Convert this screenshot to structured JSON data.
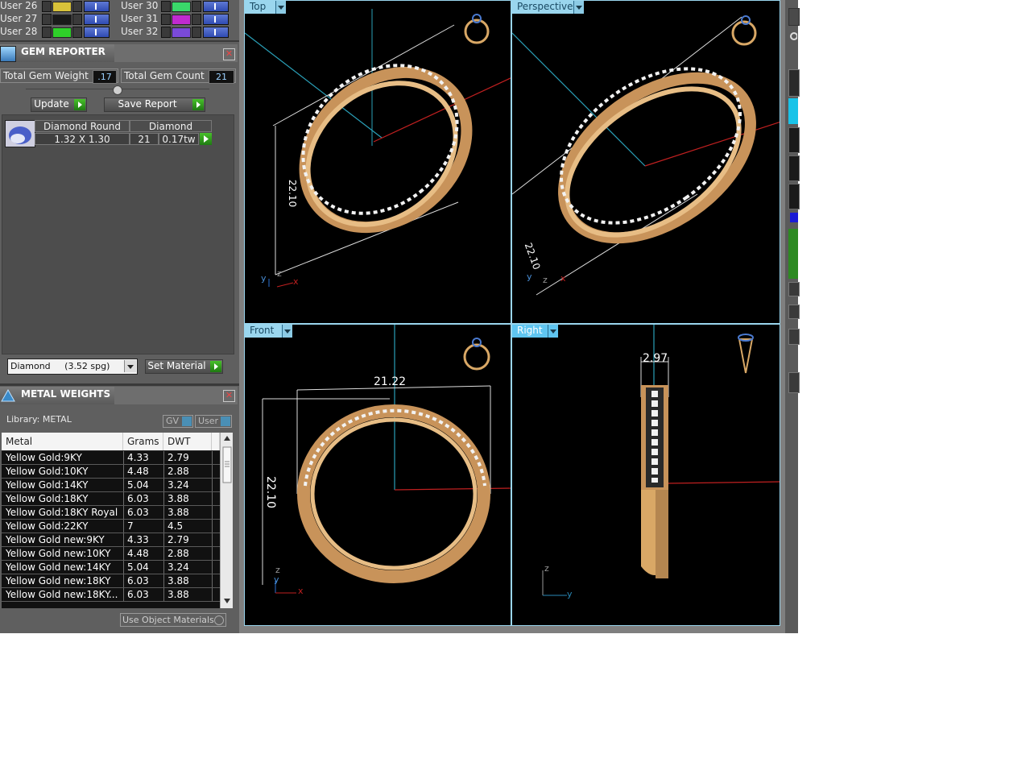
{
  "layers": [
    {
      "name": "User 26",
      "color": "#d8c23a"
    },
    {
      "name": "User 27",
      "color": "#1a1a1a"
    },
    {
      "name": "User 28",
      "color": "#2fd12a"
    },
    {
      "name": "User 30",
      "color": "#3ad86a"
    },
    {
      "name": "User 31",
      "color": "#c02ad0"
    },
    {
      "name": "User 32",
      "color": "#7a4ad8"
    }
  ],
  "gem_reporter": {
    "title": "GEM REPORTER",
    "total_weight_label": "Total Gem Weight",
    "total_weight_value": ".17",
    "total_count_label": "Total Gem Count",
    "total_count_value": "21",
    "update_label": "Update",
    "save_label": "Save Report",
    "gem": {
      "shape": "Diamond Round",
      "type": "Diamond",
      "size": "1.32 X 1.30",
      "count": "21",
      "weight": "0.17tw"
    },
    "material_select": "Diamond     (3.52 spg)",
    "set_material_label": "Set Material"
  },
  "metal_weights": {
    "title": "METAL WEIGHTS",
    "library_label": "Library: METAL",
    "gv_label": "GV",
    "user_label": "User",
    "columns": [
      "Metal",
      "Grams",
      "DWT"
    ],
    "rows": [
      [
        "Yellow Gold:9KY",
        "4.33",
        "2.79"
      ],
      [
        "Yellow Gold:10KY",
        "4.48",
        "2.88"
      ],
      [
        "Yellow Gold:14KY",
        "5.04",
        "3.24"
      ],
      [
        "Yellow Gold:18KY",
        "6.03",
        "3.88"
      ],
      [
        "Yellow Gold:18KY Royal",
        "6.03",
        "3.88"
      ],
      [
        "Yellow Gold:22KY",
        "7",
        "4.5"
      ],
      [
        "Yellow Gold new:9KY",
        "4.33",
        "2.79"
      ],
      [
        "Yellow Gold new:10KY",
        "4.48",
        "2.88"
      ],
      [
        "Yellow Gold new:14KY",
        "5.04",
        "3.24"
      ],
      [
        "Yellow Gold new:18KY",
        "6.03",
        "3.88"
      ],
      [
        "Yellow Gold new:18KY...",
        "6.03",
        "3.88"
      ]
    ],
    "use_object_label": "Use Object Materials"
  },
  "viewports": {
    "top": {
      "label": "Top",
      "dim_height": "22.10"
    },
    "perspective": {
      "label": "Perspective",
      "dim_height": "22.10"
    },
    "front": {
      "label": "Front",
      "dim_width": "21.22",
      "dim_height": "22.10"
    },
    "right": {
      "label": "Right",
      "dim_width": "2.97"
    }
  },
  "colors": {
    "gold": "#d9a866",
    "grid_blue": "#2aa0b8",
    "axis_red": "#c02020",
    "viewport_border": "#9ad6ee"
  }
}
